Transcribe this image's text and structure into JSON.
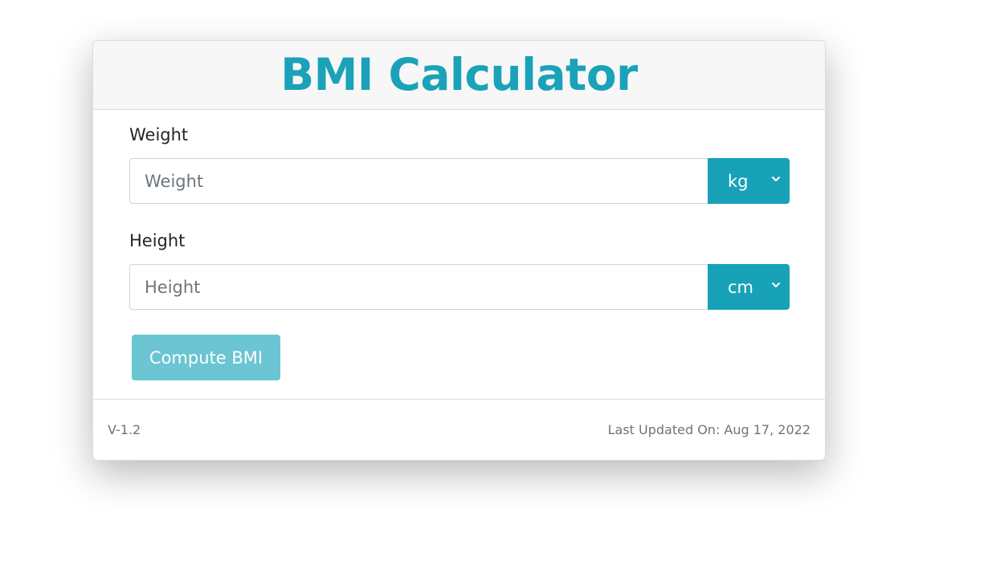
{
  "header": {
    "title": "BMI Calculator"
  },
  "form": {
    "weight": {
      "label": "Weight",
      "placeholder": "Weight",
      "value": "",
      "unit": "kg",
      "unit_icon": "chevron-down-icon"
    },
    "height": {
      "label": "Height",
      "placeholder": "Height",
      "value": "",
      "unit": "cm",
      "unit_icon": "chevron-down-icon"
    },
    "compute_label": "Compute BMI"
  },
  "footer": {
    "version": "V-1.2",
    "last_updated": "Last Updated On: Aug 17, 2022"
  },
  "colors": {
    "accent": "#17a2b8",
    "title": "#1aa2b8",
    "button": "#6bc5d2",
    "muted_text": "#6c757d"
  }
}
